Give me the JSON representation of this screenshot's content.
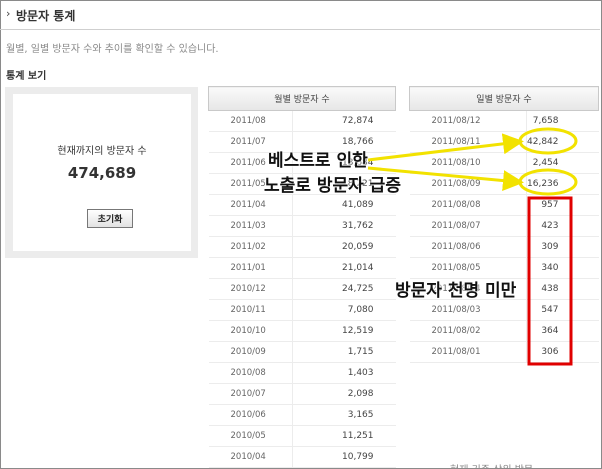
{
  "header": {
    "marker": "›",
    "title": "방문자 통계"
  },
  "subtitle": "월별, 일별 방문자 수와 추이를 확인할 수 있습니다.",
  "section_title": "통계 보기",
  "summary": {
    "label": "현재까지의 방문자 수",
    "total": "474,689",
    "reset_label": "초기화"
  },
  "monthly": {
    "header": "월별 방문자 수",
    "rows": [
      {
        "date": "2011/08",
        "count": "72,874"
      },
      {
        "date": "2011/07",
        "count": "18,766"
      },
      {
        "date": "2011/06",
        "count": "13,684"
      },
      {
        "date": "2011/05",
        "count": "8,221"
      },
      {
        "date": "2011/04",
        "count": "41,089"
      },
      {
        "date": "2011/03",
        "count": "31,762"
      },
      {
        "date": "2011/02",
        "count": "20,059"
      },
      {
        "date": "2011/01",
        "count": "21,014"
      },
      {
        "date": "2010/12",
        "count": "24,725"
      },
      {
        "date": "2010/11",
        "count": "7,080"
      },
      {
        "date": "2010/10",
        "count": "12,519"
      },
      {
        "date": "2010/09",
        "count": "1,715"
      },
      {
        "date": "2010/08",
        "count": "1,403"
      },
      {
        "date": "2010/07",
        "count": "2,098"
      },
      {
        "date": "2010/06",
        "count": "3,165"
      },
      {
        "date": "2010/05",
        "count": "11,251"
      },
      {
        "date": "2010/04",
        "count": "10,799"
      }
    ]
  },
  "daily": {
    "header": "일별 방문자 수",
    "rows": [
      {
        "date": "2011/08/12",
        "count": "7,658"
      },
      {
        "date": "2011/08/11",
        "count": "42,842"
      },
      {
        "date": "2011/08/10",
        "count": "2,454"
      },
      {
        "date": "2011/08/09",
        "count": "16,236"
      },
      {
        "date": "2011/08/08",
        "count": "957"
      },
      {
        "date": "2011/08/07",
        "count": "423"
      },
      {
        "date": "2011/08/06",
        "count": "309"
      },
      {
        "date": "2011/08/05",
        "count": "340"
      },
      {
        "date": "2011/08/04",
        "count": "438"
      },
      {
        "date": "2011/08/03",
        "count": "547"
      },
      {
        "date": "2011/08/02",
        "count": "364"
      },
      {
        "date": "2011/08/01",
        "count": "306"
      }
    ]
  },
  "annotations": {
    "exposure_line1": "베스트로 인한",
    "exposure_line2": "노출로 방문자 급증",
    "below_thousand": "방문자 천명 미만"
  },
  "bottom_text": "현재 기준 상위 방문",
  "colors": {
    "highlight_yellow": "#f2e200",
    "highlight_red": "#e00000",
    "header_bg": "#e6e6e6"
  }
}
